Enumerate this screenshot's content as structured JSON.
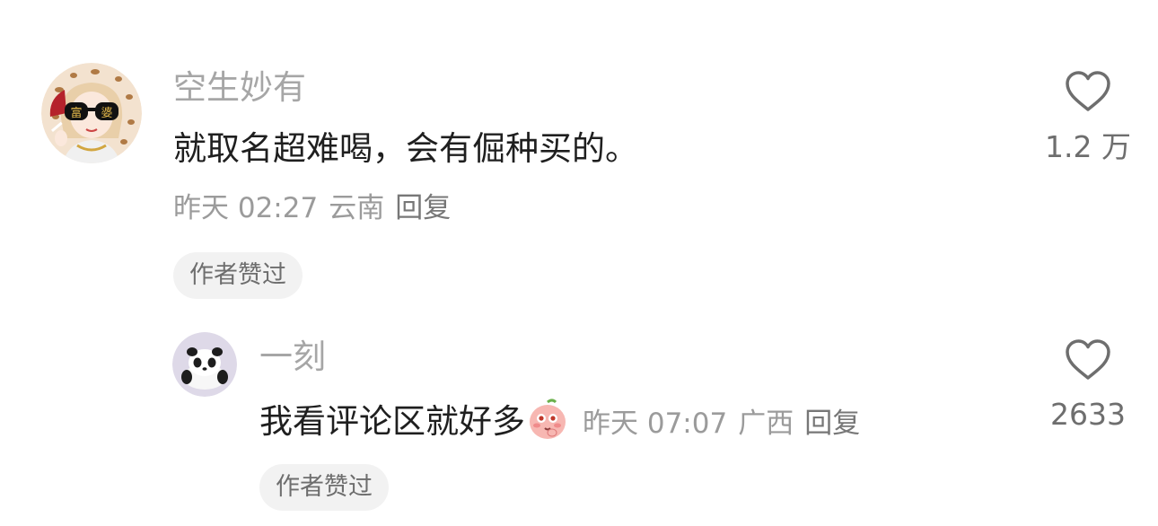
{
  "comment": {
    "username": "空生妙有",
    "avatar_icon": "avatar-glamour-lady-icon",
    "avatar_glasses_text": [
      "富",
      "婆"
    ],
    "text": "就取名超难喝，会有倔种买的。",
    "time": "昨天 02:27",
    "location": "云南",
    "reply_label": "回复",
    "badge": "作者赞过",
    "like_count": "1.2 万",
    "like_icon": "heart-outline-icon"
  },
  "reply": {
    "username": "一刻",
    "avatar_icon": "avatar-panda-plush-icon",
    "text": "我看评论区就好多",
    "emoji_icon": "peach-shy-emoji-icon",
    "time": "昨天 07:07",
    "location": "广西",
    "reply_label": "回复",
    "badge": "作者赞过",
    "like_count": "2633",
    "like_icon": "heart-outline-icon"
  },
  "colors": {
    "username": "#a6a6a6",
    "text": "#1f1f1f",
    "meta": "#9b9b9b",
    "badge_bg": "#f2f2f2",
    "icon": "#6e6e6e"
  }
}
